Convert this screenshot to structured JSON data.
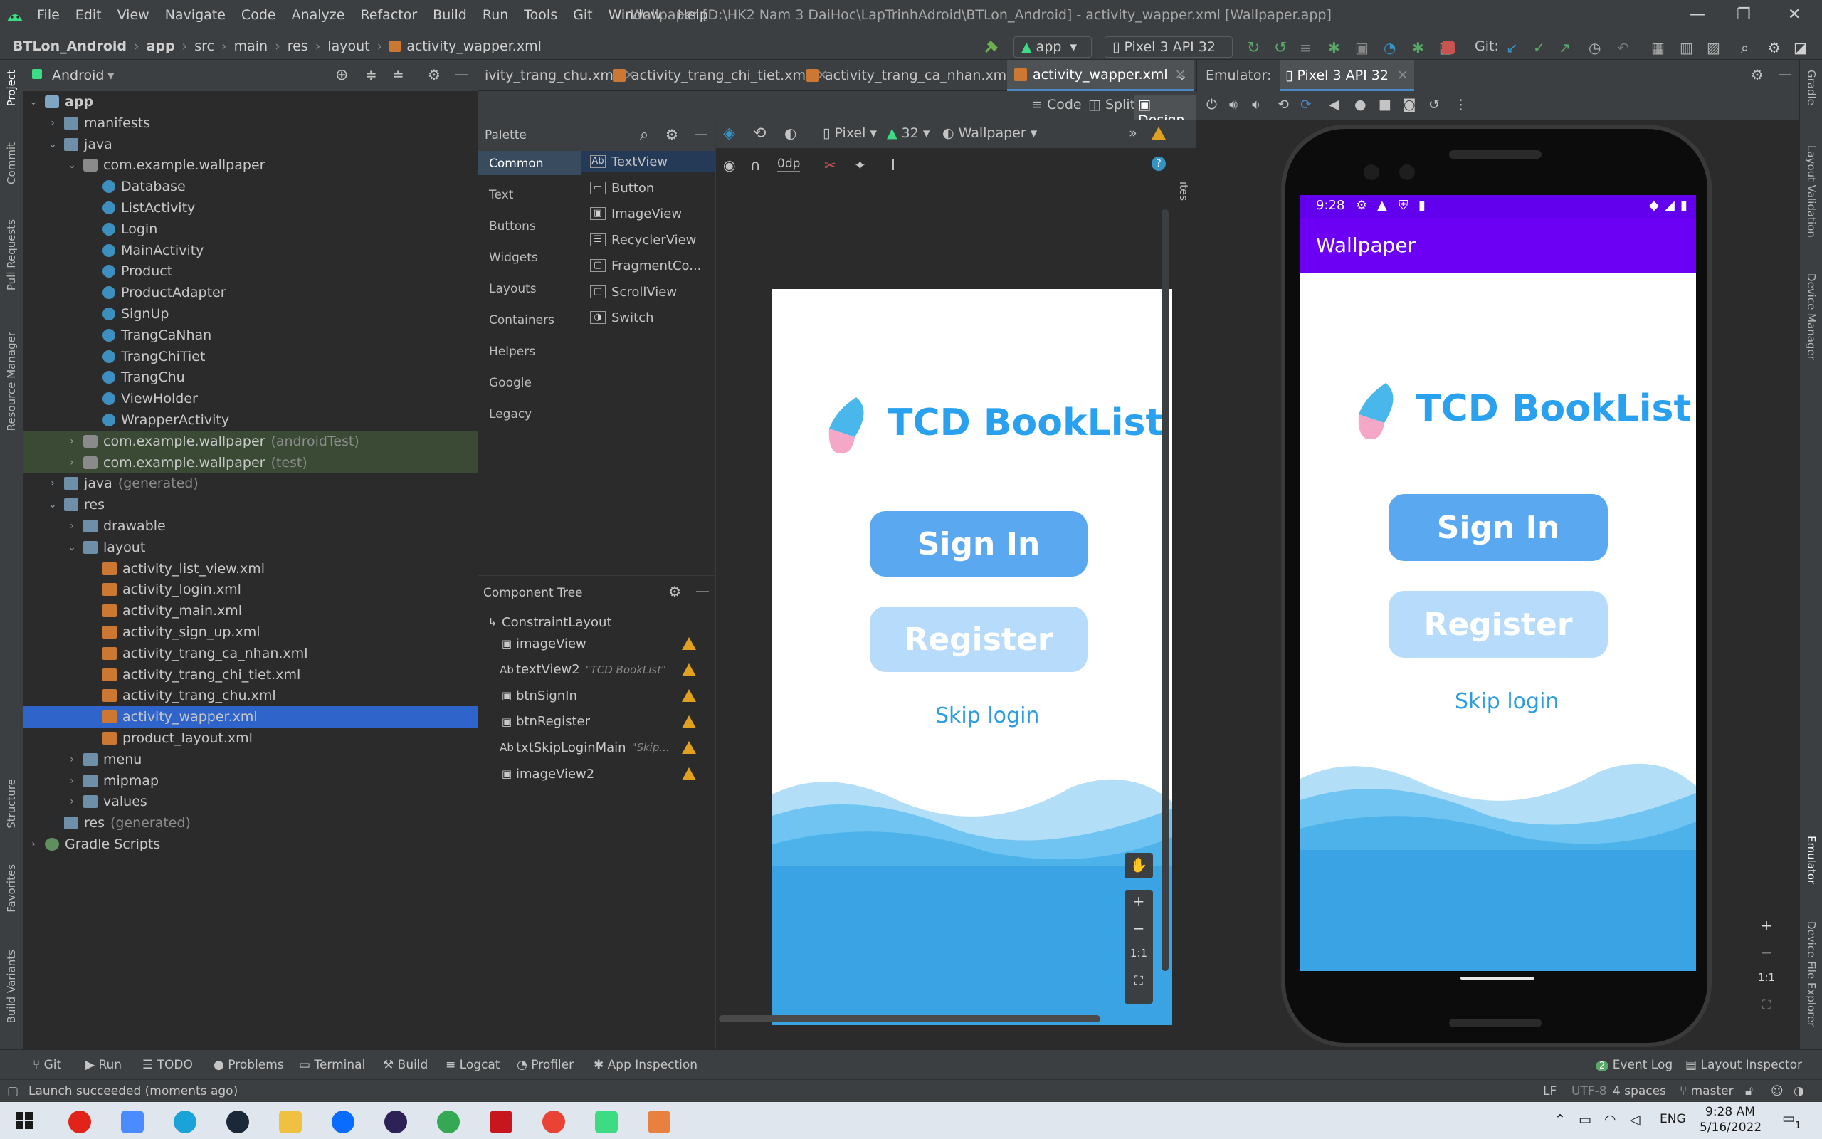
{
  "menu": {
    "items": [
      "File",
      "Edit",
      "View",
      "Navigate",
      "Code",
      "Analyze",
      "Refactor",
      "Build",
      "Run",
      "Tools",
      "Git",
      "Window",
      "Help"
    ],
    "window_title": "Wallpaper [D:\\HK2 Nam 3 DaiHoc\\LapTrinhAdroid\\BTLon_Android] - activity_wapper.xml [Wallpaper.app]"
  },
  "navbar": {
    "crumbs": [
      "BTLon_Android",
      "app",
      "src",
      "main",
      "res",
      "layout",
      "activity_wapper.xml"
    ],
    "run_config": "app",
    "device": "Pixel 3 API 32",
    "git_label": "Git:"
  },
  "project": {
    "view_mode": "Android",
    "tree": [
      {
        "label": "app",
        "indent": 0,
        "arrow": "open",
        "icon": "module",
        "bold": true
      },
      {
        "label": "manifests",
        "indent": 1,
        "arrow": "closed",
        "icon": "folder"
      },
      {
        "label": "java",
        "indent": 1,
        "arrow": "open",
        "icon": "folder"
      },
      {
        "label": "com.example.wallpaper",
        "indent": 2,
        "arrow": "open",
        "icon": "pkg"
      },
      {
        "label": "Database",
        "indent": 3,
        "arrow": "",
        "icon": "cls"
      },
      {
        "label": "ListActivity",
        "indent": 3,
        "arrow": "",
        "icon": "cls"
      },
      {
        "label": "Login",
        "indent": 3,
        "arrow": "",
        "icon": "cls"
      },
      {
        "label": "MainActivity",
        "indent": 3,
        "arrow": "",
        "icon": "cls"
      },
      {
        "label": "Product",
        "indent": 3,
        "arrow": "",
        "icon": "cls"
      },
      {
        "label": "ProductAdapter",
        "indent": 3,
        "arrow": "",
        "icon": "cls"
      },
      {
        "label": "SignUp",
        "indent": 3,
        "arrow": "",
        "icon": "cls"
      },
      {
        "label": "TrangCaNhan",
        "indent": 3,
        "arrow": "",
        "icon": "cls"
      },
      {
        "label": "TrangChiTiet",
        "indent": 3,
        "arrow": "",
        "icon": "cls"
      },
      {
        "label": "TrangChu",
        "indent": 3,
        "arrow": "",
        "icon": "cls"
      },
      {
        "label": "ViewHolder",
        "indent": 3,
        "arrow": "",
        "icon": "cls"
      },
      {
        "label": "WrapperActivity",
        "indent": 3,
        "arrow": "",
        "icon": "cls"
      },
      {
        "label": "com.example.wallpaper",
        "dim": "(androidTest)",
        "indent": 2,
        "arrow": "closed",
        "icon": "pkg",
        "test": true
      },
      {
        "label": "com.example.wallpaper",
        "dim": "(test)",
        "indent": 2,
        "arrow": "closed",
        "icon": "pkg",
        "test": true
      },
      {
        "label": "java",
        "dim": "(generated)",
        "indent": 1,
        "arrow": "closed",
        "icon": "folder"
      },
      {
        "label": "res",
        "indent": 1,
        "arrow": "open",
        "icon": "folder"
      },
      {
        "label": "drawable",
        "indent": 2,
        "arrow": "closed",
        "icon": "folder"
      },
      {
        "label": "layout",
        "indent": 2,
        "arrow": "open",
        "icon": "folder"
      },
      {
        "label": "activity_list_view.xml",
        "indent": 3,
        "arrow": "",
        "icon": "xml"
      },
      {
        "label": "activity_login.xml",
        "indent": 3,
        "arrow": "",
        "icon": "xml"
      },
      {
        "label": "activity_main.xml",
        "indent": 3,
        "arrow": "",
        "icon": "xml"
      },
      {
        "label": "activity_sign_up.xml",
        "indent": 3,
        "arrow": "",
        "icon": "xml"
      },
      {
        "label": "activity_trang_ca_nhan.xml",
        "indent": 3,
        "arrow": "",
        "icon": "xml"
      },
      {
        "label": "activity_trang_chi_tiet.xml",
        "indent": 3,
        "arrow": "",
        "icon": "xml"
      },
      {
        "label": "activity_trang_chu.xml",
        "indent": 3,
        "arrow": "",
        "icon": "xml"
      },
      {
        "label": "activity_wapper.xml",
        "indent": 3,
        "arrow": "",
        "icon": "xml",
        "selected": true
      },
      {
        "label": "product_layout.xml",
        "indent": 3,
        "arrow": "",
        "icon": "xml"
      },
      {
        "label": "menu",
        "indent": 2,
        "arrow": "closed",
        "icon": "folder"
      },
      {
        "label": "mipmap",
        "indent": 2,
        "arrow": "closed",
        "icon": "folder"
      },
      {
        "label": "values",
        "indent": 2,
        "arrow": "closed",
        "icon": "folder"
      },
      {
        "label": "res",
        "dim": "(generated)",
        "indent": 1,
        "arrow": "",
        "icon": "folder"
      },
      {
        "label": "Gradle Scripts",
        "indent": 0,
        "arrow": "closed",
        "icon": "gradle"
      }
    ]
  },
  "left_strip": [
    "Project",
    "Commit",
    "Pull Requests",
    "Resource Manager",
    "Structure",
    "Favorites",
    "Build Variants"
  ],
  "right_strip": [
    "Gradle",
    "Layout Validation",
    "Device Manager",
    "Emulator",
    "Device File Explorer"
  ],
  "editor": {
    "tabs": [
      {
        "label": "ivity_trang_chu.xml",
        "active": false
      },
      {
        "label": "activity_trang_chi_tiet.xml",
        "active": false
      },
      {
        "label": "activity_trang_ca_nhan.xml",
        "active": false
      },
      {
        "label": "activity_wapper.xml",
        "active": true
      }
    ],
    "modes": {
      "code": "Code",
      "split": "Split",
      "design": "Design"
    },
    "design_toolbar": {
      "device": "Pixel",
      "api": "32",
      "theme": "Wallpaper",
      "margin": "0dp"
    }
  },
  "palette": {
    "title": "Palette",
    "categories": [
      "Common",
      "Text",
      "Buttons",
      "Widgets",
      "Layouts",
      "Containers",
      "Helpers",
      "Google",
      "Legacy"
    ],
    "items": [
      {
        "label": "TextView",
        "glyph": "Ab"
      },
      {
        "label": "Button",
        "glyph": ""
      },
      {
        "label": "ImageView",
        "glyph": ""
      },
      {
        "label": "RecyclerView",
        "glyph": ""
      },
      {
        "label": "FragmentCo...",
        "glyph": ""
      },
      {
        "label": "ScrollView",
        "glyph": ""
      },
      {
        "label": "Switch",
        "glyph": ""
      }
    ]
  },
  "component_tree": {
    "title": "Component Tree",
    "root": "ConstraintLayout",
    "children": [
      {
        "label": "imageView",
        "glyph": "img",
        "hint": ""
      },
      {
        "label": "textView2",
        "glyph": "Ab",
        "hint": "\"TCD BookList\""
      },
      {
        "label": "btnSignIn",
        "glyph": "img",
        "hint": ""
      },
      {
        "label": "btnRegister",
        "glyph": "img",
        "hint": ""
      },
      {
        "label": "txtSkipLoginMain",
        "glyph": "Ab",
        "hint": "\"Skip..."
      },
      {
        "label": "imageView2",
        "glyph": "img",
        "hint": ""
      }
    ]
  },
  "app_screen": {
    "brand_title": "TCD BookList",
    "sign_in_label": "Sign In",
    "register_label": "Register",
    "skip_label": "Skip login",
    "appbar_title": "Wallpaper",
    "status_time": "9:28",
    "brand_color": "#2aa1ee",
    "appbar_color": "#6b00f5"
  },
  "emulator": {
    "label": "Emulator:",
    "device_tab": "Pixel 3 API 32"
  },
  "bottom_tools": [
    "Git",
    "Run",
    "TODO",
    "Problems",
    "Terminal",
    "Build",
    "Logcat",
    "Profiler",
    "App Inspection"
  ],
  "bottom_tools_right": {
    "event_log": "Event Log",
    "event_count": "2",
    "layout_inspector": "Layout Inspector"
  },
  "status": {
    "message": "Launch succeeded (moments ago)",
    "line_sep": "LF",
    "encoding": "UTF-8",
    "indent": "4 spaces",
    "branch": "master"
  },
  "taskbar": {
    "lang": "ENG",
    "time": "9:28 AM",
    "date": "5/16/2022",
    "notif": "1"
  }
}
